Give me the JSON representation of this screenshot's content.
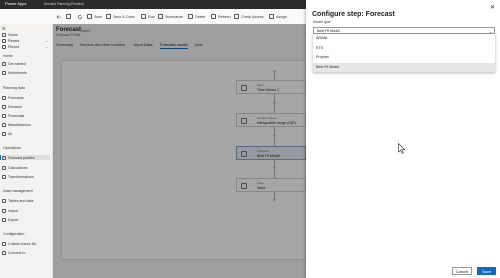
{
  "topbar": {
    "brand": "Power Apps",
    "app_name": "Demand Planning (Preview)"
  },
  "cmdbar": {
    "back_icon": "back-arrow-icon",
    "items": [
      {
        "label": "Save"
      },
      {
        "label": "Save & Close"
      },
      {
        "label": "Run"
      },
      {
        "label": "Summarize"
      },
      {
        "label": "Delete"
      },
      {
        "label": "Refresh"
      },
      {
        "label": "Check Access"
      },
      {
        "label": "Assign"
      }
    ]
  },
  "sidebar": {
    "top_items": [
      {
        "label": "Home"
      },
      {
        "label": "Recent",
        "icon": "clock-icon"
      },
      {
        "label": "Pinned",
        "icon": "pin-icon"
      }
    ],
    "sections": [
      {
        "title": "Home",
        "items": [
          {
            "label": "Get started"
          },
          {
            "label": "Worksheets"
          }
        ]
      },
      {
        "title": "Planning data",
        "items": [
          {
            "label": "Forecasts"
          },
          {
            "label": "Demand"
          },
          {
            "label": "Financials"
          },
          {
            "label": "Miscellaneous"
          },
          {
            "label": "All"
          }
        ]
      },
      {
        "title": "Operations",
        "items": [
          {
            "label": "Forecast profiles"
          },
          {
            "label": "Calculations"
          },
          {
            "label": "Transformations"
          }
        ]
      },
      {
        "title": "Data management",
        "items": [
          {
            "label": "Tables and data"
          },
          {
            "label": "Import"
          },
          {
            "label": "Export"
          }
        ]
      },
      {
        "title": "Configuration",
        "items": [
          {
            "label": "Custom Azure ML"
          },
          {
            "label": "Connect to"
          }
        ]
      }
    ]
  },
  "main": {
    "title": "Forecast",
    "saved_status": "- Saved",
    "subtitle": "Forecast Profile",
    "tabs": [
      {
        "label": "Summary"
      },
      {
        "label": "Horizon and time buckets"
      },
      {
        "label": "Input Data"
      },
      {
        "label": "Forecast model"
      },
      {
        "label": "Jobs"
      }
    ],
    "active_tab": "Forecast model",
    "nodes": [
      {
        "label": "Input",
        "name": "Time Series 1"
      },
      {
        "label": "Handle outliers",
        "name": "Interquartile range (IQR)"
      },
      {
        "label": "Forecast",
        "name": "Best Fit Model"
      },
      {
        "label": "Save",
        "name": "Save"
      }
    ]
  },
  "panel": {
    "title": "Configure step: Forecast",
    "field_label": "Model type",
    "selected_value": "Best Fit Model",
    "options": [
      {
        "label": "ARIMA"
      },
      {
        "label": "ETS"
      },
      {
        "label": "Prophet"
      },
      {
        "label": "Best Fit Model"
      }
    ],
    "cancel_label": "Cancel",
    "save_label": "Save"
  },
  "colors": {
    "accent": "#0f6cbd",
    "topbar": "#2b2b2b",
    "sidebar": "#f3f2f1"
  }
}
